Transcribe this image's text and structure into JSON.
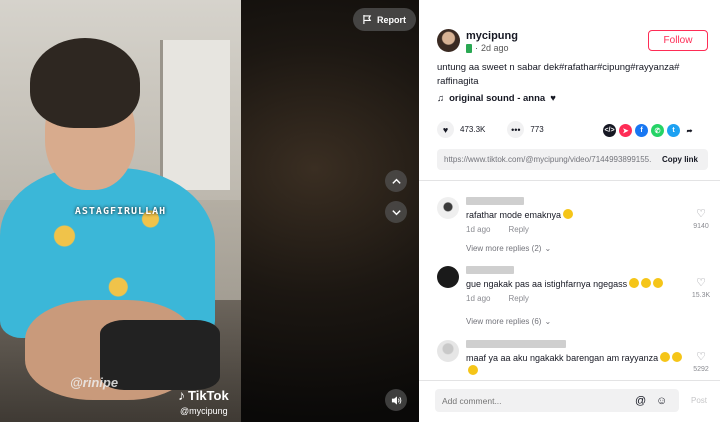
{
  "video": {
    "report_label": "Report",
    "caption_overlay": "ASTAGFIRULLAH",
    "watermark": "@rinipe",
    "tiktok_brand": "TikTok",
    "tiktok_handle": "@mycipung",
    "icons": {
      "report": "flag-icon",
      "prev": "chevron-up-icon",
      "next": "chevron-down-icon",
      "volume": "speaker-icon"
    }
  },
  "author": {
    "username": "mycipung",
    "time": "2d ago",
    "follow_label": "Follow"
  },
  "post": {
    "description": "untung aa sweet n sabar dek#rafathar#cipung#rayyanza#",
    "description_line2": "raffinagita",
    "sound": "original sound - anna",
    "likes": "473.3K",
    "comments_count": "773",
    "link": "https://www.tiktok.com/@mycipung/video/7144993899155...",
    "copy_label": "Copy link",
    "share_colors": {
      "embed": "#161823",
      "send": "#fe2c55",
      "facebook": "#1877f2",
      "whatsapp": "#25d366",
      "twitter": "#1da1f2"
    }
  },
  "comments": [
    {
      "text": "rafathar mode emaknya",
      "date": "1d ago",
      "reply_label": "Reply",
      "likes": "9140",
      "view_more": "View more replies (2)"
    },
    {
      "text": "gue ngakak pas aa istighfarnya ngegass",
      "date": "1d ago",
      "reply_label": "Reply",
      "likes": "15.3K",
      "view_more": "View more replies (6)"
    },
    {
      "text": "maaf ya aa aku ngakakk barengan am rayyanza",
      "likes": "5292"
    }
  ],
  "comment_bar": {
    "placeholder": "Add comment...",
    "post_label": "Post"
  }
}
